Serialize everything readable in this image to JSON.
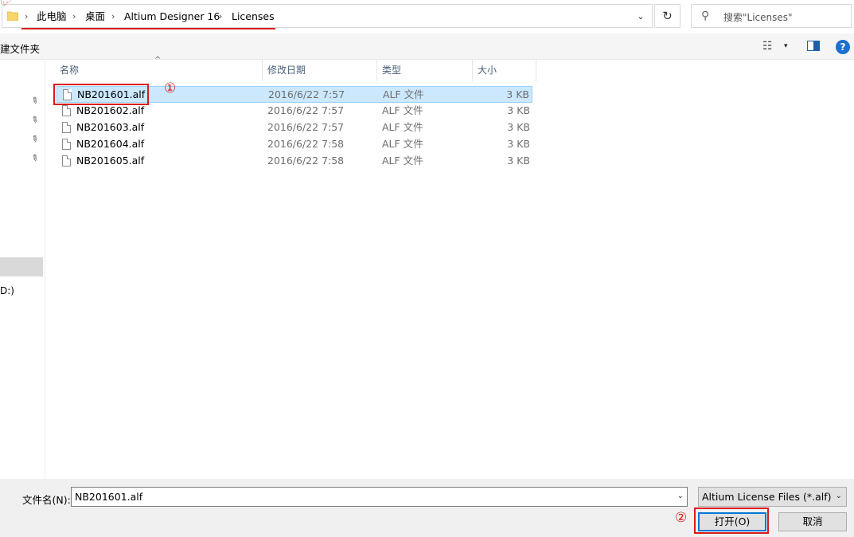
{
  "address": {
    "breadcrumbs": [
      "此电脑",
      "桌面",
      "Altium Designer 16",
      "Licenses"
    ],
    "separator": "›",
    "dropdown_icon": "chevron-down-icon",
    "refresh_icon": "refresh-icon"
  },
  "search": {
    "placeholder": "搜索\"Licenses\"",
    "icon": "search-icon"
  },
  "toolbar": {
    "new_folder": "建文件夹",
    "view_glyph": "☷",
    "view_arrow": "▾",
    "help": "?"
  },
  "nav": {
    "drive_label": "D:)",
    "pin_glyph": "📌"
  },
  "columns": {
    "name": "名称",
    "date": "修改日期",
    "type": "类型",
    "size": "大小"
  },
  "files": [
    {
      "name": "NB201601.alf",
      "date": "2016/6/22 7:57",
      "type": "ALF 文件",
      "size": "3 KB",
      "selected": true
    },
    {
      "name": "NB201602.alf",
      "date": "2016/6/22 7:57",
      "type": "ALF 文件",
      "size": "3 KB",
      "selected": false
    },
    {
      "name": "NB201603.alf",
      "date": "2016/6/22 7:57",
      "type": "ALF 文件",
      "size": "3 KB",
      "selected": false
    },
    {
      "name": "NB201604.alf",
      "date": "2016/6/22 7:58",
      "type": "ALF 文件",
      "size": "3 KB",
      "selected": false
    },
    {
      "name": "NB201605.alf",
      "date": "2016/6/22 7:58",
      "type": "ALF 文件",
      "size": "3 KB",
      "selected": false
    }
  ],
  "annotations": {
    "step1": "①",
    "step2": "②",
    "color": "#d91a1a"
  },
  "bottom": {
    "filename_label": "文件名(N):",
    "filename_value": "NB201601.alf",
    "filter_value": "Altium License Files (*.alf)",
    "open_label": "打开(O)",
    "cancel_label": "取消"
  },
  "colors": {
    "selection": "#cce8ff",
    "selection_border": "#99d1ff",
    "accent": "#0078d7",
    "header_text": "#4c607a"
  }
}
